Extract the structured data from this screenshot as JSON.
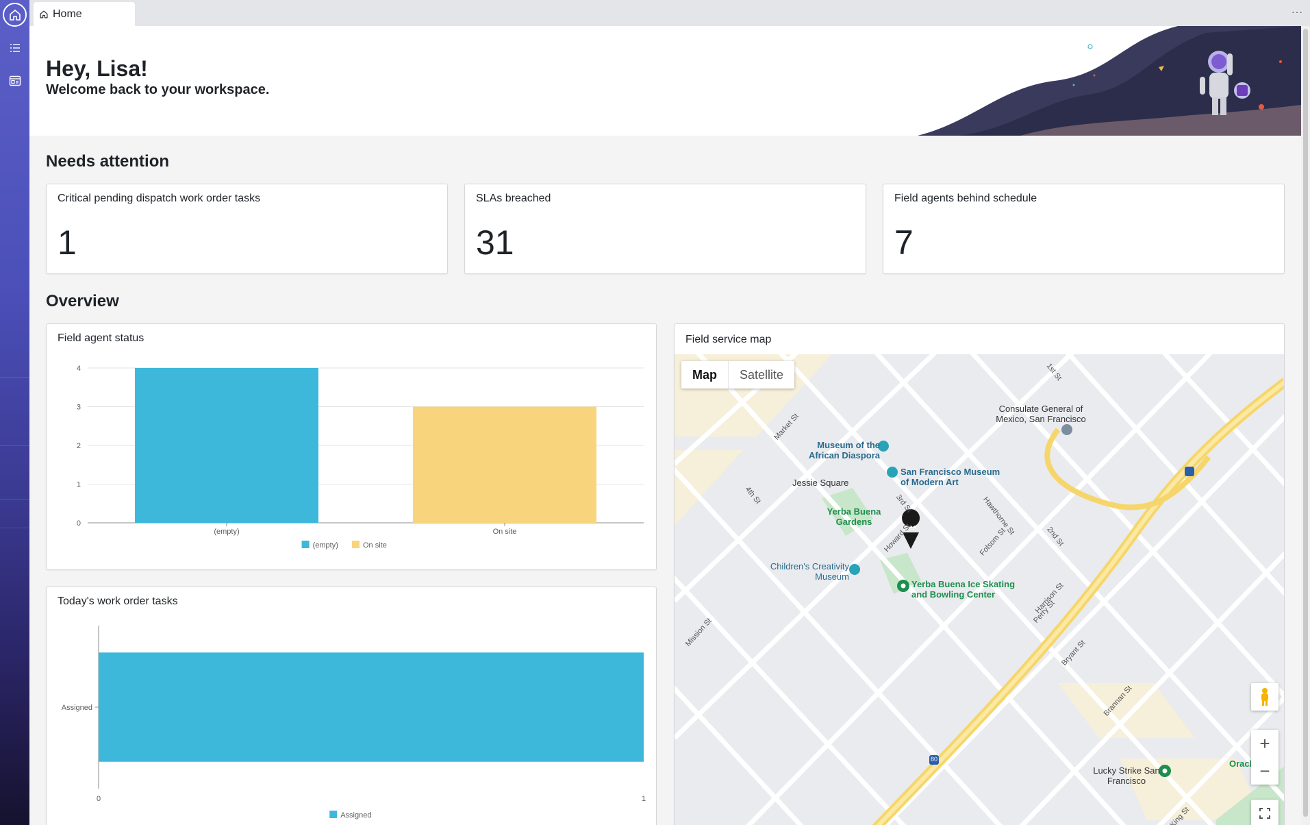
{
  "tabs": {
    "home_label": "Home",
    "more": "···"
  },
  "sidebar": {
    "items": [
      {
        "icon": "home-icon"
      },
      {
        "icon": "list-icon"
      },
      {
        "icon": "dashboard-icon"
      }
    ]
  },
  "banner": {
    "greeting": "Hey, Lisa!",
    "welcome": "Welcome back to your workspace."
  },
  "needs_attention": {
    "title": "Needs attention",
    "cards": [
      {
        "label": "Critical pending dispatch work order tasks",
        "value": "1"
      },
      {
        "label": "SLAs breached",
        "value": "31"
      },
      {
        "label": "Field agents behind schedule",
        "value": "7"
      }
    ]
  },
  "overview": {
    "title": "Overview"
  },
  "field_agent_status": {
    "title": "Field agent status"
  },
  "todays_tasks": {
    "title": "Today's work order tasks"
  },
  "map": {
    "title": "Field service map",
    "toggle": {
      "map": "Map",
      "satellite": "Satellite"
    },
    "zoom_in": "+",
    "zoom_out": "−",
    "labels": {
      "consulate": "Consulate General of Mexico, San Francisco",
      "museum_african": "Museum of the African Diaspora",
      "sfmoma": "San Francisco Museum of Modern Art",
      "jessie_square": "Jessie Square",
      "yerba_gardens": "Yerba Buena Gardens",
      "childrens": "Children's Creativity Museum",
      "ice_skating": "Yerba Buena Ice Skating and Bowling Center",
      "lucky_strike": "Lucky Strike San Francisco",
      "oracle": "Oracle Pa",
      "market_st": "Market St",
      "third_st": "3rd St",
      "fourth_st": "4th St",
      "howard_st": "Howard St",
      "folsom_st": "Folsom St",
      "harrison_st": "Harrison St",
      "bryant_st": "Bryant St",
      "brannan_st": "Brannan St",
      "mission_st": "Mission St",
      "second_st": "2nd St",
      "first_st": "1st St",
      "hawthorne_st": "Hawthorne St",
      "perry_st": "Perry St",
      "king_st": "King St",
      "i80": "80"
    }
  },
  "chart_data": [
    {
      "type": "bar",
      "categories": [
        "(empty)",
        "On site"
      ],
      "values": [
        4,
        3
      ],
      "title": "Field agent status",
      "ylim": [
        0,
        4
      ],
      "yticks": [
        0,
        1,
        2,
        3,
        4
      ],
      "series_colors": [
        "#3db8db",
        "#f8d47d"
      ],
      "legend": [
        "(empty)",
        "On site"
      ],
      "legend_position": "bottom",
      "grid": true
    },
    {
      "type": "bar",
      "orientation": "horizontal",
      "categories": [
        "Assigned"
      ],
      "values": [
        1
      ],
      "title": "Today's work order tasks",
      "xlim": [
        0,
        1
      ],
      "xticks": [
        0,
        1
      ],
      "series_colors": [
        "#3db8db"
      ],
      "legend": [
        "Assigned"
      ],
      "legend_position": "bottom",
      "grid": false
    }
  ]
}
